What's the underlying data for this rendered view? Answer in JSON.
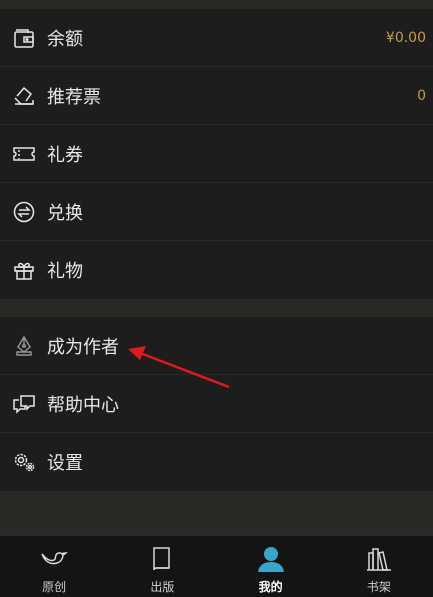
{
  "menu_group_1": [
    {
      "label": "余额",
      "value": "¥0.00",
      "icon": "wallet-icon"
    },
    {
      "label": "推荐票",
      "value": "0",
      "icon": "ticket-icon"
    },
    {
      "label": "礼券",
      "value": "",
      "icon": "coupon-icon"
    },
    {
      "label": "兑换",
      "value": "",
      "icon": "exchange-icon"
    },
    {
      "label": "礼物",
      "value": "",
      "icon": "gift-icon"
    }
  ],
  "menu_group_2": [
    {
      "label": "成为作者",
      "icon": "pen-nib-icon"
    },
    {
      "label": "帮助中心",
      "icon": "help-chat-icon"
    },
    {
      "label": "设置",
      "icon": "settings-gears-icon"
    }
  ],
  "tabbar": [
    {
      "label": "原创",
      "icon": "bird-icon",
      "active": false
    },
    {
      "label": "出版",
      "icon": "book-icon",
      "active": false
    },
    {
      "label": "我的",
      "icon": "user-icon",
      "active": true
    },
    {
      "label": "书架",
      "icon": "bookshelf-icon",
      "active": false
    }
  ],
  "colors": {
    "accent": "#c79a45",
    "active_tab": "#37a6c9",
    "annotation_arrow": "#e01a1a"
  }
}
